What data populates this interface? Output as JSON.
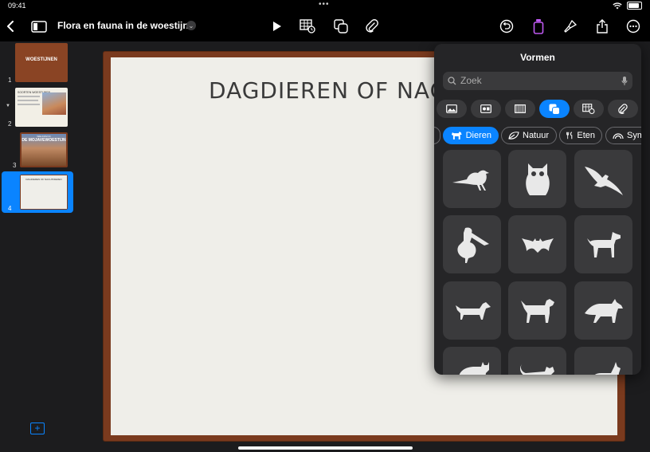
{
  "status": {
    "time": "09:41",
    "dots": "•••"
  },
  "toolbar": {
    "title": "Flora en fauna in de woestijn"
  },
  "slides": [
    {
      "number": "1",
      "title": "WOESTIJNEN"
    },
    {
      "number": "2",
      "title": "SOORTEN WOESTIJNEN"
    },
    {
      "number": "3",
      "title": "DE MOJAVEWOESTIJN",
      "kicker": "WELKOM IN"
    },
    {
      "number": "4",
      "title": "DAGDIEREN OF NACHTDIEREN"
    }
  ],
  "slide": {
    "heading": "DAGDIEREN OF NACH"
  },
  "shapes_popover": {
    "title": "Vormen",
    "search_placeholder": "Zoek",
    "categories": [
      "Dieren",
      "Natuur",
      "Eten",
      "Sym"
    ],
    "tiles": [
      "bird",
      "owl",
      "eagle",
      "pelican",
      "bat",
      "dog",
      "dachshund",
      "hound",
      "wolf",
      "cat",
      "cat",
      "cat"
    ]
  },
  "colors": {
    "accent": "#0a84ff",
    "frame": "#7a3a1e",
    "paper": "#efeee9"
  }
}
